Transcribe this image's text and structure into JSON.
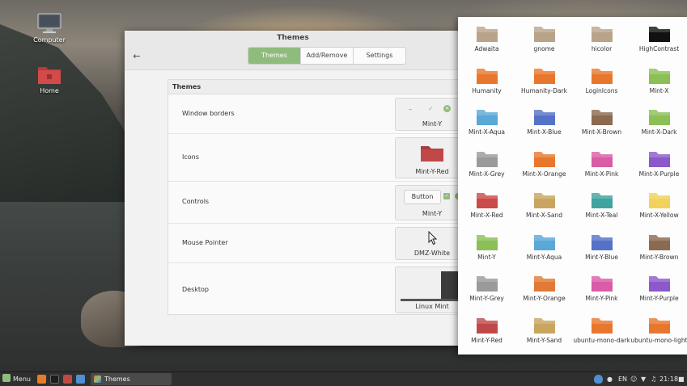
{
  "desktop": {
    "icons": [
      {
        "label": "Computer"
      },
      {
        "label": "Home"
      }
    ]
  },
  "window": {
    "title": "Themes",
    "tabs": [
      {
        "label": "Themes",
        "active": true
      },
      {
        "label": "Add/Remove",
        "active": false
      },
      {
        "label": "Settings",
        "active": false
      }
    ],
    "section_title": "Themes",
    "rows": [
      {
        "label": "Window borders",
        "value": "Mint-Y"
      },
      {
        "label": "Icons",
        "value": "Mint-Y-Red"
      },
      {
        "label": "Controls",
        "value": "Mint-Y",
        "button_label": "Button"
      },
      {
        "label": "Mouse Pointer",
        "value": "DMZ-White"
      },
      {
        "label": "Desktop",
        "value": "Linux Mint"
      }
    ]
  },
  "icon_themes": [
    {
      "label": "Adwaita",
      "color": "#b9a48a"
    },
    {
      "label": "gnome",
      "color": "#b9a48a"
    },
    {
      "label": "hicolor",
      "color": "#b9a48a"
    },
    {
      "label": "HighContrast",
      "color": "#111111"
    },
    {
      "label": "Humanity",
      "color": "#e8772e"
    },
    {
      "label": "Humanity-Dark",
      "color": "#e8772e"
    },
    {
      "label": "LoginIcons",
      "color": "#e8772e"
    },
    {
      "label": "Mint-X",
      "color": "#8cbf55"
    },
    {
      "label": "Mint-X-Aqua",
      "color": "#5aa8d8"
    },
    {
      "label": "Mint-X-Blue",
      "color": "#5672c8"
    },
    {
      "label": "Mint-X-Brown",
      "color": "#8b6a50"
    },
    {
      "label": "Mint-X-Dark",
      "color": "#8cbf55"
    },
    {
      "label": "Mint-X-Grey",
      "color": "#9a9a9a"
    },
    {
      "label": "Mint-X-Orange",
      "color": "#e8772e"
    },
    {
      "label": "Mint-X-Pink",
      "color": "#d95ca6"
    },
    {
      "label": "Mint-X-Purple",
      "color": "#8b59c9"
    },
    {
      "label": "Mint-X-Red",
      "color": "#cc4a4a"
    },
    {
      "label": "Mint-X-Sand",
      "color": "#c9a560"
    },
    {
      "label": "Mint-X-Teal",
      "color": "#3fa3a0"
    },
    {
      "label": "Mint-X-Yellow",
      "color": "#f2d25a"
    },
    {
      "label": "Mint-Y",
      "color": "#8cbf55"
    },
    {
      "label": "Mint-Y-Aqua",
      "color": "#5aa8d8"
    },
    {
      "label": "Mint-Y-Blue",
      "color": "#5672c8"
    },
    {
      "label": "Mint-Y-Brown",
      "color": "#8b6a50"
    },
    {
      "label": "Mint-Y-Grey",
      "color": "#9a9a9a"
    },
    {
      "label": "Mint-Y-Orange",
      "color": "#e07a35"
    },
    {
      "label": "Mint-Y-Pink",
      "color": "#d95ca6"
    },
    {
      "label": "Mint-Y-Purple",
      "color": "#8b59c9"
    },
    {
      "label": "Mint-Y-Red",
      "color": "#c04848"
    },
    {
      "label": "Mint-Y-Sand",
      "color": "#c9a560"
    },
    {
      "label": "ubuntu-mono-dark",
      "color": "#e8772e"
    },
    {
      "label": "ubuntu-mono-light",
      "color": "#e8772e"
    }
  ],
  "taskbar": {
    "menu_label": "Menu",
    "window_label": "Themes",
    "language": "EN",
    "time": "21:18"
  },
  "colors": {
    "accent": "#8fbc7d",
    "taskbar": "#2f2f2f"
  }
}
